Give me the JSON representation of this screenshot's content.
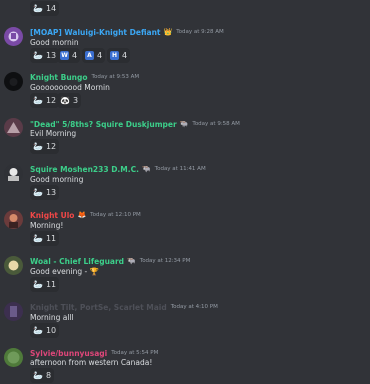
{
  "top_reaction": {
    "emoji": "🦢",
    "count": "14"
  },
  "messages": [
    {
      "author": "[MOAP] Waluigi-Knight Defiant",
      "author_color": "#3ba7f4",
      "role_icon": "👑",
      "timestamp": "Today at 9:28 AM",
      "text": "Good mornin",
      "avatar_color": "#7a4aa6",
      "reactions": [
        {
          "emoji": "🦢",
          "count": "13"
        },
        {
          "emoji": "W",
          "count": "4"
        },
        {
          "emoji": "A",
          "count": "4"
        },
        {
          "emoji": "H",
          "count": "4"
        }
      ]
    },
    {
      "author": "Knight Bungo",
      "author_color": "#3ccf8a",
      "role_icon": "",
      "timestamp": "Today at 9:53 AM",
      "text": "Goooooooood Mornin",
      "avatar_color": "#0e0f11",
      "reactions": [
        {
          "emoji": "🦢",
          "count": "12"
        },
        {
          "emoji": "🐼",
          "count": "3"
        }
      ]
    },
    {
      "author": "\"Dead\" 5/8ths? Squire Duskjumper",
      "author_color": "#3ccf8a",
      "role_icon": "🐃",
      "timestamp": "Today at 9:58 AM",
      "text": "Evil Morning",
      "avatar_color": "#5a3b48",
      "reactions": [
        {
          "emoji": "🦢",
          "count": "12"
        }
      ]
    },
    {
      "author": "Squire Moshen233 D.M.C.",
      "author_color": "#3ccf8a",
      "role_icon": "🐃",
      "timestamp": "Today at 11:41 AM",
      "text": "Good morning",
      "avatar_color": "#2f3136",
      "reactions": [
        {
          "emoji": "🦢",
          "count": "13"
        }
      ]
    },
    {
      "author": "Knight Ulo",
      "author_color": "#f04747",
      "role_icon": "🦊",
      "timestamp": "Today at 12:10 PM",
      "text": "Morning!",
      "avatar_color": "#6b3b3b",
      "reactions": [
        {
          "emoji": "🦢",
          "count": "11"
        }
      ]
    },
    {
      "author": "Woal - Chief Lifeguard",
      "author_color": "#3ccf8a",
      "role_icon": "🐃",
      "timestamp": "Today at 12:34 PM",
      "text": "Good evening - 🏆",
      "avatar_color": "#4a5a3a",
      "reactions": [
        {
          "emoji": "🦢",
          "count": "11"
        }
      ]
    },
    {
      "author": "Knight Tilt, PortSe, Scarlet Maid",
      "author_color": "#4e5058",
      "role_icon": "",
      "timestamp": "Today at 4:10 PM",
      "text": "Morning alll",
      "avatar_color": "#3c2f4f",
      "reactions": [
        {
          "emoji": "🦢",
          "count": "10"
        }
      ]
    },
    {
      "author": "Sylvie/bunnyusagi",
      "author_color": "#e0467a",
      "role_icon": "",
      "timestamp": "Today at 5:54 PM",
      "text": "afternoon from western Canada!",
      "avatar_color": "#4f7a3a",
      "reactions": [
        {
          "emoji": "🦢",
          "count": "8"
        }
      ]
    }
  ]
}
